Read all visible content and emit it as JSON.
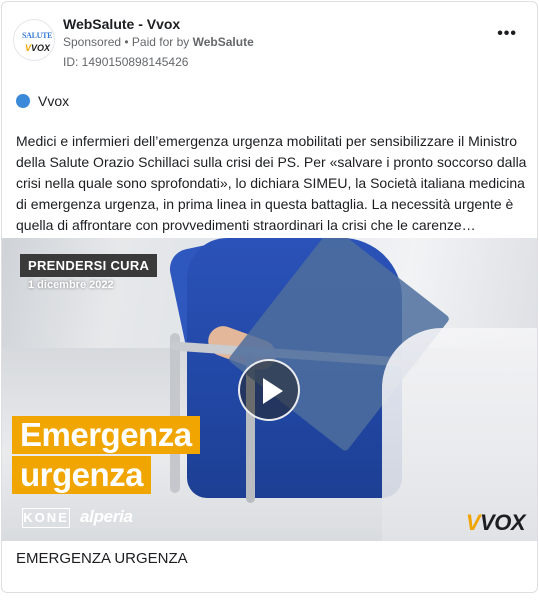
{
  "advertiser": {
    "name": "WebSalute - Vvox",
    "avatar_logo_top": "SALUTE",
    "avatar_logo_bottom": "VOX",
    "sponsored_label": "Sponsored",
    "separator": " • ",
    "paid_for_prefix": "Paid for by ",
    "paid_for_name": "WebSalute",
    "ad_id": "ID: 1490150898145426"
  },
  "menu": {
    "more_label": "•••"
  },
  "platform": {
    "label": "Vvox",
    "color": "#3b8ad9"
  },
  "body_text": "Medici e infermieri dell’emergenza urgenza mobilitati per sensibilizzare il Ministro della Salute Orazio Schillaci sulla crisi dei PS. Per «salvare i pronto soccorso dalla crisi nella quale sono sprofondati», lo dichiara SIMEU, la Società italiana medicina di emergenza urgenza, in prima linea in questa battaglia. La necessità urgente è quella di affrontare con provvedimenti straordinari la crisi che le carenze strutturali…",
  "media": {
    "tag": "PRENDERSI CURA",
    "date": "1 dicembre 2022",
    "headline_line1": "Emergenza",
    "headline_line2": "urgenza",
    "sponsor_1": "KONE",
    "sponsor_2": "alperia",
    "brand": "VOX",
    "accent_color": "#f0a500"
  },
  "caption": "EMERGENZA URGENZA"
}
